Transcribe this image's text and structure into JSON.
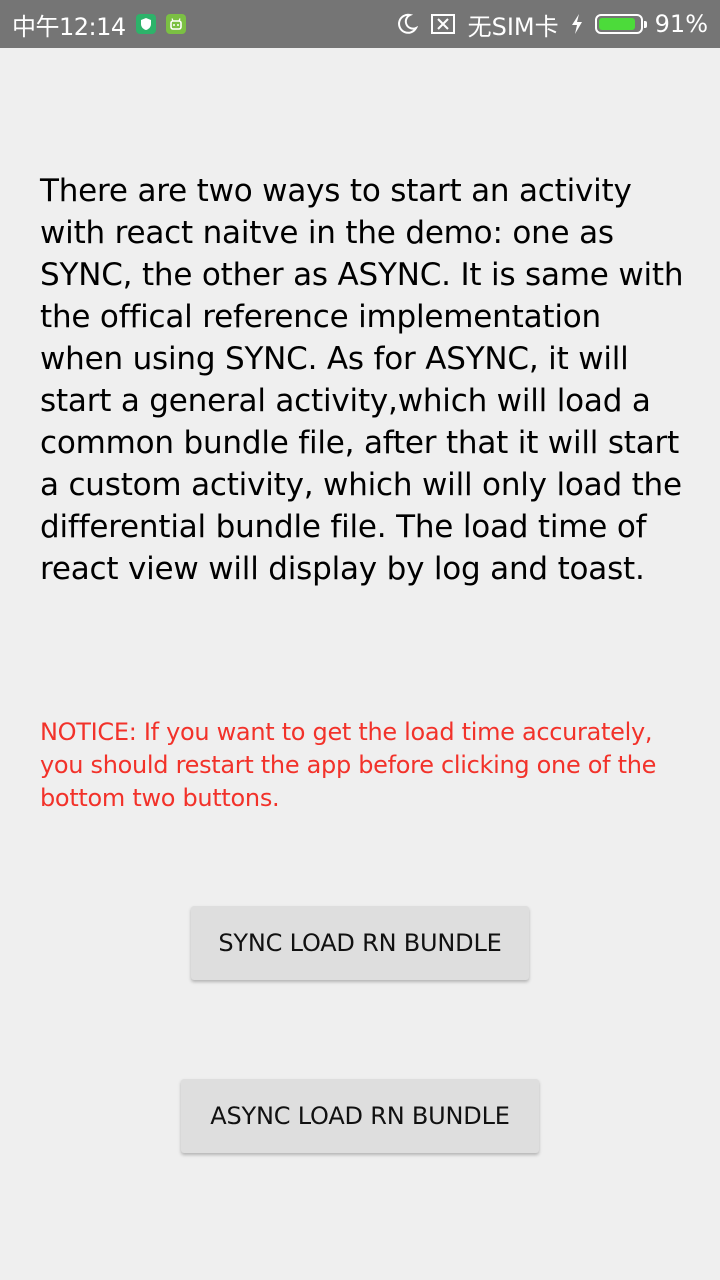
{
  "status_bar": {
    "time": "中午12:14",
    "app_icons": [
      "shield-icon",
      "android-icon"
    ],
    "app_icon_colors": [
      "#2db36a",
      "#7bc043"
    ],
    "moon_icon": "moon-icon",
    "sim_icon": "no-sim-box-icon",
    "sim_text": "无SIM卡",
    "charging_icon": "lightning-icon",
    "battery_level": 0.91,
    "battery_color": "#4cdb3a",
    "battery_text": "91%"
  },
  "main": {
    "description": "There are two ways to start an activity with react naitve in the demo: one as SYNC, the other as ASYNC. It is same with the offical reference implementation when using SYNC. As for ASYNC, it will start a general activity,which will load a common bundle file, after that it will start a custom activity, which will only load the differential bundle file. The load time of react view will display by log and toast.",
    "notice": "NOTICE: If you want to get the load time accurately, you should restart the app before clicking one of the bottom two buttons.",
    "notice_color": "#f2322a"
  },
  "buttons": {
    "sync_label": "SYNC LOAD RN BUNDLE",
    "async_label": "ASYNC LOAD RN BUNDLE"
  }
}
